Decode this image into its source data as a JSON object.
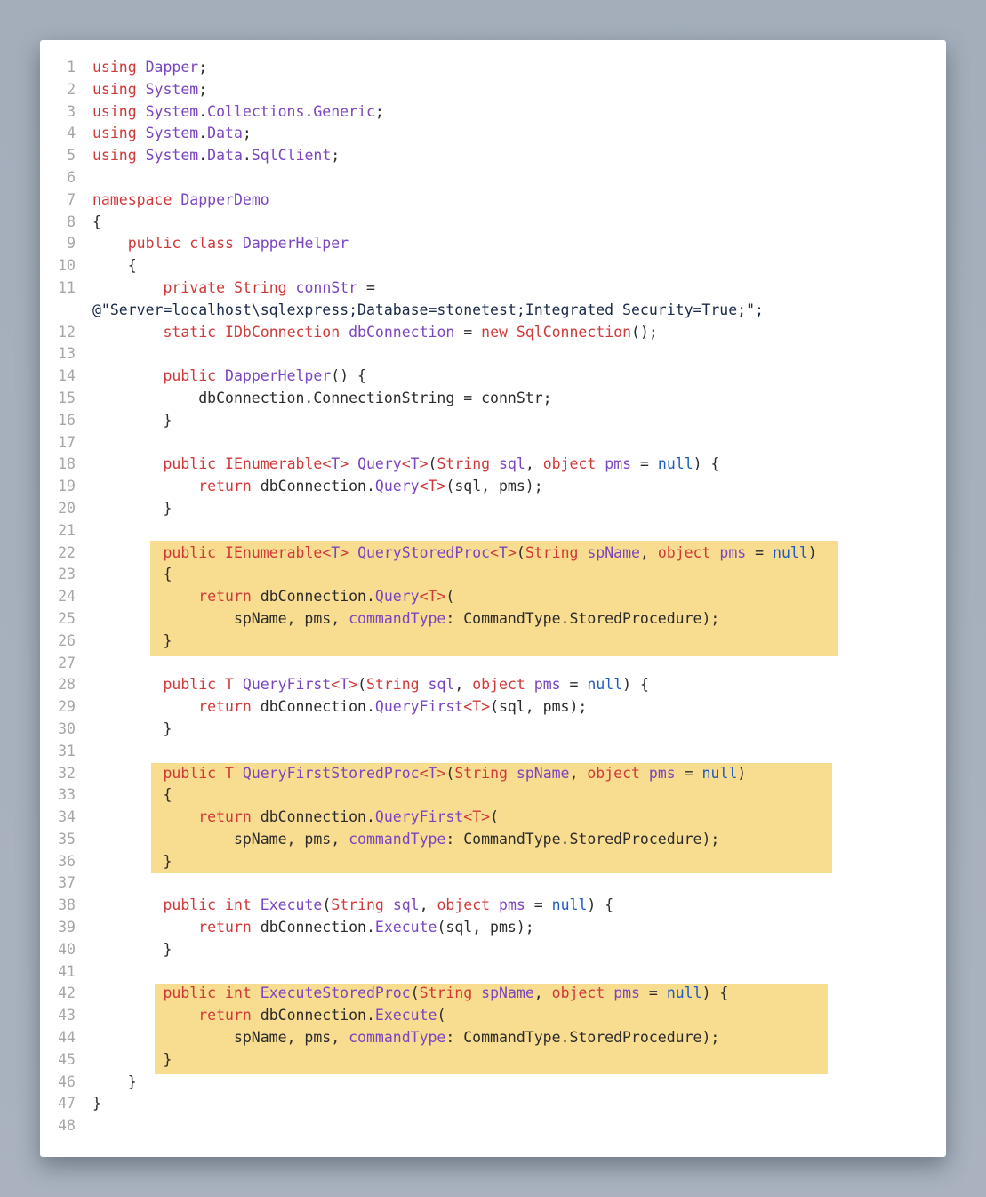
{
  "colors": {
    "background": "#a9b2be",
    "card": "#ffffff",
    "highlight": "#f8dc90",
    "keyword": "#d13939",
    "type": "#7a45c0",
    "null_literal": "#1d5cc4",
    "plain": "#2b2b2b",
    "line_number": "#a6a6a6"
  },
  "code_lines": [
    {
      "n": "1",
      "tokens": [
        [
          "k",
          "using"
        ],
        [
          "p",
          " "
        ],
        [
          "t",
          "Dapper"
        ],
        [
          "p",
          ";"
        ]
      ]
    },
    {
      "n": "2",
      "tokens": [
        [
          "k",
          "using"
        ],
        [
          "p",
          " "
        ],
        [
          "t",
          "System"
        ],
        [
          "p",
          ";"
        ]
      ]
    },
    {
      "n": "3",
      "tokens": [
        [
          "k",
          "using"
        ],
        [
          "p",
          " "
        ],
        [
          "t",
          "System"
        ],
        [
          "p",
          "."
        ],
        [
          "t",
          "Collections"
        ],
        [
          "p",
          "."
        ],
        [
          "t",
          "Generic"
        ],
        [
          "p",
          ";"
        ]
      ]
    },
    {
      "n": "4",
      "tokens": [
        [
          "k",
          "using"
        ],
        [
          "p",
          " "
        ],
        [
          "t",
          "System"
        ],
        [
          "p",
          "."
        ],
        [
          "t",
          "Data"
        ],
        [
          "p",
          ";"
        ]
      ]
    },
    {
      "n": "5",
      "tokens": [
        [
          "k",
          "using"
        ],
        [
          "p",
          " "
        ],
        [
          "t",
          "System"
        ],
        [
          "p",
          "."
        ],
        [
          "t",
          "Data"
        ],
        [
          "p",
          "."
        ],
        [
          "t",
          "SqlClient"
        ],
        [
          "p",
          ";"
        ]
      ]
    },
    {
      "n": "6",
      "tokens": []
    },
    {
      "n": "7",
      "tokens": [
        [
          "k",
          "namespace"
        ],
        [
          "p",
          " "
        ],
        [
          "t",
          "DapperDemo"
        ]
      ]
    },
    {
      "n": "8",
      "tokens": [
        [
          "p",
          "{"
        ]
      ]
    },
    {
      "n": "9",
      "tokens": [
        [
          "p",
          "    "
        ],
        [
          "k",
          "public"
        ],
        [
          "p",
          " "
        ],
        [
          "k",
          "class"
        ],
        [
          "p",
          " "
        ],
        [
          "t",
          "DapperHelper"
        ]
      ]
    },
    {
      "n": "10",
      "tokens": [
        [
          "p",
          "    {"
        ]
      ]
    },
    {
      "n": "11",
      "tokens": [
        [
          "p",
          "        "
        ],
        [
          "k",
          "private"
        ],
        [
          "p",
          " "
        ],
        [
          "k",
          "String"
        ],
        [
          "p",
          " "
        ],
        [
          "t",
          "connStr"
        ],
        [
          "p",
          " ="
        ]
      ]
    },
    {
      "n": "",
      "tokens": [
        [
          "s",
          "@\"Server=localhost\\sqlexpress;Database=stonetest;Integrated Security=True;\";"
        ]
      ]
    },
    {
      "n": "12",
      "tokens": [
        [
          "p",
          "        "
        ],
        [
          "k",
          "static"
        ],
        [
          "p",
          " "
        ],
        [
          "k",
          "IDbConnection"
        ],
        [
          "p",
          " "
        ],
        [
          "t",
          "dbConnection"
        ],
        [
          "p",
          " = "
        ],
        [
          "k",
          "new"
        ],
        [
          "p",
          " "
        ],
        [
          "k",
          "SqlConnection"
        ],
        [
          "p",
          "();"
        ]
      ]
    },
    {
      "n": "13",
      "tokens": []
    },
    {
      "n": "14",
      "tokens": [
        [
          "p",
          "        "
        ],
        [
          "k",
          "public"
        ],
        [
          "p",
          " "
        ],
        [
          "t",
          "DapperHelper"
        ],
        [
          "p",
          "() {"
        ]
      ]
    },
    {
      "n": "15",
      "tokens": [
        [
          "p",
          "            dbConnection.ConnectionString = connStr;"
        ]
      ]
    },
    {
      "n": "16",
      "tokens": [
        [
          "p",
          "        }"
        ]
      ]
    },
    {
      "n": "17",
      "tokens": []
    },
    {
      "n": "18",
      "tokens": [
        [
          "p",
          "        "
        ],
        [
          "k",
          "public"
        ],
        [
          "p",
          " "
        ],
        [
          "k",
          "IEnumerable"
        ],
        [
          "k",
          "<"
        ],
        [
          "t",
          "T"
        ],
        [
          "k",
          ">"
        ],
        [
          "p",
          " "
        ],
        [
          "t",
          "Query"
        ],
        [
          "k",
          "<"
        ],
        [
          "t",
          "T"
        ],
        [
          "k",
          ">"
        ],
        [
          "p",
          "("
        ],
        [
          "k",
          "String"
        ],
        [
          "p",
          " "
        ],
        [
          "t",
          "sql"
        ],
        [
          "p",
          ", "
        ],
        [
          "k",
          "object"
        ],
        [
          "p",
          " "
        ],
        [
          "t",
          "pms"
        ],
        [
          "p",
          " = "
        ],
        [
          "n",
          "null"
        ],
        [
          "p",
          ") {"
        ]
      ]
    },
    {
      "n": "19",
      "tokens": [
        [
          "p",
          "            "
        ],
        [
          "k",
          "return"
        ],
        [
          "p",
          " dbConnection."
        ],
        [
          "t",
          "Query"
        ],
        [
          "k",
          "<"
        ],
        [
          "k",
          "T"
        ],
        [
          "k",
          ">"
        ],
        [
          "p",
          "(sql, pms);"
        ]
      ]
    },
    {
      "n": "20",
      "tokens": [
        [
          "p",
          "        }"
        ]
      ]
    },
    {
      "n": "21",
      "tokens": []
    },
    {
      "n": "22",
      "tokens": [
        [
          "p",
          "        "
        ],
        [
          "k",
          "public"
        ],
        [
          "p",
          " "
        ],
        [
          "k",
          "IEnumerable"
        ],
        [
          "k",
          "<"
        ],
        [
          "t",
          "T"
        ],
        [
          "k",
          ">"
        ],
        [
          "p",
          " "
        ],
        [
          "t",
          "QueryStoredProc"
        ],
        [
          "k",
          "<"
        ],
        [
          "t",
          "T"
        ],
        [
          "k",
          ">"
        ],
        [
          "p",
          "("
        ],
        [
          "k",
          "String"
        ],
        [
          "p",
          " "
        ],
        [
          "t",
          "spName"
        ],
        [
          "p",
          ", "
        ],
        [
          "k",
          "object"
        ],
        [
          "p",
          " "
        ],
        [
          "t",
          "pms"
        ],
        [
          "p",
          " = "
        ],
        [
          "n",
          "null"
        ],
        [
          "p",
          ")"
        ]
      ]
    },
    {
      "n": "23",
      "tokens": [
        [
          "p",
          "        {"
        ]
      ]
    },
    {
      "n": "24",
      "tokens": [
        [
          "p",
          "            "
        ],
        [
          "k",
          "return"
        ],
        [
          "p",
          " dbConnection."
        ],
        [
          "t",
          "Query"
        ],
        [
          "k",
          "<"
        ],
        [
          "k",
          "T"
        ],
        [
          "k",
          ">"
        ],
        [
          "p",
          "("
        ]
      ]
    },
    {
      "n": "25",
      "tokens": [
        [
          "p",
          "                spName, pms, "
        ],
        [
          "t",
          "commandType"
        ],
        [
          "p",
          ": CommandType.StoredProcedure);"
        ]
      ]
    },
    {
      "n": "26",
      "tokens": [
        [
          "p",
          "        }"
        ]
      ]
    },
    {
      "n": "27",
      "tokens": []
    },
    {
      "n": "28",
      "tokens": [
        [
          "p",
          "        "
        ],
        [
          "k",
          "public"
        ],
        [
          "p",
          " "
        ],
        [
          "k",
          "T"
        ],
        [
          "p",
          " "
        ],
        [
          "t",
          "QueryFirst"
        ],
        [
          "k",
          "<"
        ],
        [
          "t",
          "T"
        ],
        [
          "k",
          ">"
        ],
        [
          "p",
          "("
        ],
        [
          "k",
          "String"
        ],
        [
          "p",
          " "
        ],
        [
          "t",
          "sql"
        ],
        [
          "p",
          ", "
        ],
        [
          "k",
          "object"
        ],
        [
          "p",
          " "
        ],
        [
          "t",
          "pms"
        ],
        [
          "p",
          " = "
        ],
        [
          "n",
          "null"
        ],
        [
          "p",
          ") {"
        ]
      ]
    },
    {
      "n": "29",
      "tokens": [
        [
          "p",
          "            "
        ],
        [
          "k",
          "return"
        ],
        [
          "p",
          " dbConnection."
        ],
        [
          "t",
          "QueryFirst"
        ],
        [
          "k",
          "<"
        ],
        [
          "k",
          "T"
        ],
        [
          "k",
          ">"
        ],
        [
          "p",
          "(sql, pms);"
        ]
      ]
    },
    {
      "n": "30",
      "tokens": [
        [
          "p",
          "        }"
        ]
      ]
    },
    {
      "n": "31",
      "tokens": []
    },
    {
      "n": "32",
      "tokens": [
        [
          "p",
          "        "
        ],
        [
          "k",
          "public"
        ],
        [
          "p",
          " "
        ],
        [
          "k",
          "T"
        ],
        [
          "p",
          " "
        ],
        [
          "t",
          "QueryFirstStoredProc"
        ],
        [
          "k",
          "<"
        ],
        [
          "t",
          "T"
        ],
        [
          "k",
          ">"
        ],
        [
          "p",
          "("
        ],
        [
          "k",
          "String"
        ],
        [
          "p",
          " "
        ],
        [
          "t",
          "spName"
        ],
        [
          "p",
          ", "
        ],
        [
          "k",
          "object"
        ],
        [
          "p",
          " "
        ],
        [
          "t",
          "pms"
        ],
        [
          "p",
          " = "
        ],
        [
          "n",
          "null"
        ],
        [
          "p",
          ")"
        ]
      ]
    },
    {
      "n": "33",
      "tokens": [
        [
          "p",
          "        {"
        ]
      ]
    },
    {
      "n": "34",
      "tokens": [
        [
          "p",
          "            "
        ],
        [
          "k",
          "return"
        ],
        [
          "p",
          " dbConnection."
        ],
        [
          "t",
          "QueryFirst"
        ],
        [
          "k",
          "<"
        ],
        [
          "k",
          "T"
        ],
        [
          "k",
          ">"
        ],
        [
          "p",
          "("
        ]
      ]
    },
    {
      "n": "35",
      "tokens": [
        [
          "p",
          "                spName, pms, "
        ],
        [
          "t",
          "commandType"
        ],
        [
          "p",
          ": CommandType.StoredProcedure);"
        ]
      ]
    },
    {
      "n": "36",
      "tokens": [
        [
          "p",
          "        }"
        ]
      ]
    },
    {
      "n": "37",
      "tokens": []
    },
    {
      "n": "38",
      "tokens": [
        [
          "p",
          "        "
        ],
        [
          "k",
          "public"
        ],
        [
          "p",
          " "
        ],
        [
          "k",
          "int"
        ],
        [
          "p",
          " "
        ],
        [
          "t",
          "Execute"
        ],
        [
          "p",
          "("
        ],
        [
          "k",
          "String"
        ],
        [
          "p",
          " "
        ],
        [
          "t",
          "sql"
        ],
        [
          "p",
          ", "
        ],
        [
          "k",
          "object"
        ],
        [
          "p",
          " "
        ],
        [
          "t",
          "pms"
        ],
        [
          "p",
          " = "
        ],
        [
          "n",
          "null"
        ],
        [
          "p",
          ") {"
        ]
      ]
    },
    {
      "n": "39",
      "tokens": [
        [
          "p",
          "            "
        ],
        [
          "k",
          "return"
        ],
        [
          "p",
          " dbConnection."
        ],
        [
          "t",
          "Execute"
        ],
        [
          "p",
          "(sql, pms);"
        ]
      ]
    },
    {
      "n": "40",
      "tokens": [
        [
          "p",
          "        }"
        ]
      ]
    },
    {
      "n": "41",
      "tokens": []
    },
    {
      "n": "42",
      "tokens": [
        [
          "p",
          "        "
        ],
        [
          "k",
          "public"
        ],
        [
          "p",
          " "
        ],
        [
          "k",
          "int"
        ],
        [
          "p",
          " "
        ],
        [
          "t",
          "ExecuteStoredProc"
        ],
        [
          "p",
          "("
        ],
        [
          "k",
          "String"
        ],
        [
          "p",
          " "
        ],
        [
          "t",
          "spName"
        ],
        [
          "p",
          ", "
        ],
        [
          "k",
          "object"
        ],
        [
          "p",
          " "
        ],
        [
          "t",
          "pms"
        ],
        [
          "p",
          " = "
        ],
        [
          "n",
          "null"
        ],
        [
          "p",
          ") {"
        ]
      ]
    },
    {
      "n": "43",
      "tokens": [
        [
          "p",
          "            "
        ],
        [
          "k",
          "return"
        ],
        [
          "p",
          " dbConnection."
        ],
        [
          "t",
          "Execute"
        ],
        [
          "p",
          "("
        ]
      ]
    },
    {
      "n": "44",
      "tokens": [
        [
          "p",
          "                spName, pms, "
        ],
        [
          "t",
          "commandType"
        ],
        [
          "p",
          ": CommandType.StoredProcedure);"
        ]
      ]
    },
    {
      "n": "45",
      "tokens": [
        [
          "p",
          "        }"
        ]
      ]
    },
    {
      "n": "46",
      "tokens": [
        [
          "p",
          "    }"
        ]
      ]
    },
    {
      "n": "47",
      "tokens": [
        [
          "p",
          "}"
        ]
      ]
    },
    {
      "n": "48",
      "tokens": []
    }
  ]
}
